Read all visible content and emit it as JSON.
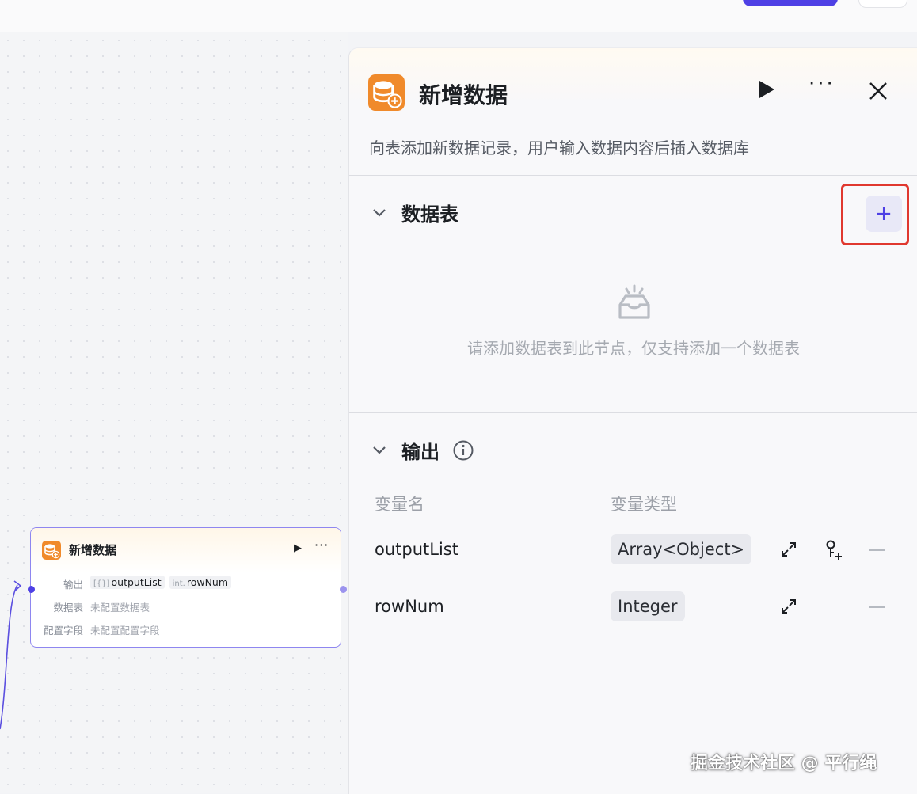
{
  "panel": {
    "title": "新增数据",
    "description": "向表添加新数据记录，用户输入数据内容后插入数据库",
    "datatable_section": {
      "title": "数据表",
      "add_label": "+",
      "empty_text": "请添加数据表到此节点，仅支持添加一个数据表"
    },
    "output_section": {
      "title": "输出",
      "col_name": "变量名",
      "col_type": "变量类型",
      "rows": [
        {
          "name": "outputList",
          "type": "Array<Object>"
        },
        {
          "name": "rowNum",
          "type": "Integer"
        }
      ]
    }
  },
  "node": {
    "title": "新增数据",
    "output_label": "输出",
    "output_tags": [
      {
        "prefix": "[{}]",
        "name": "outputList"
      },
      {
        "prefix": "int.",
        "name": "rowNum"
      }
    ],
    "datatable_label": "数据表",
    "datatable_value": "未配置数据表",
    "fields_label": "配置字段",
    "fields_value": "未配置配置字段"
  },
  "watermark": "掘金技术社区 @ 平行绳",
  "colors": {
    "accent": "#4e40e5",
    "node_icon": "#f08a2b",
    "highlight": "#e0382f"
  }
}
